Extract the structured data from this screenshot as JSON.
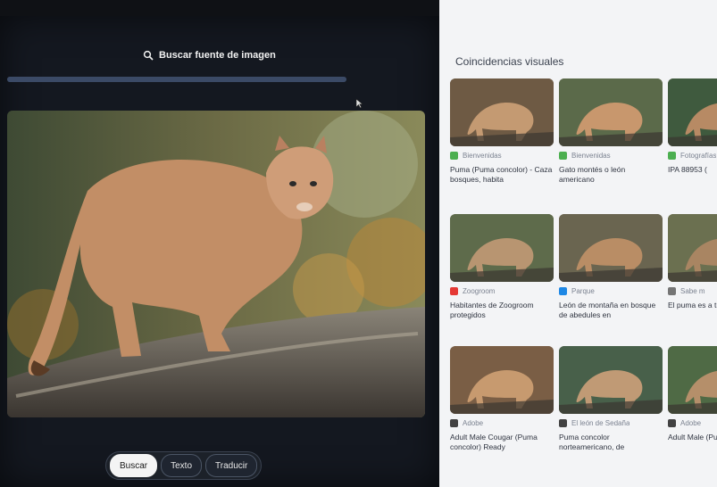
{
  "lens": {
    "search_source_label": "Buscar fuente de imagen",
    "progress": 1.0,
    "actions": [
      {
        "label": "Buscar",
        "active": true
      },
      {
        "label": "Texto",
        "active": false
      },
      {
        "label": "Traducir",
        "active": false
      }
    ]
  },
  "results": {
    "title": "Coincidencias visuales",
    "items": [
      {
        "source": "Bienvenidas",
        "caption": "Puma (Puma concolor) - Caza bosques, habita",
        "icon_color": "#4caf50"
      },
      {
        "source": "Bienvenidas",
        "caption": "Gato montés o león americano",
        "icon_color": "#4caf50"
      },
      {
        "source": "Fotografías",
        "caption": "IPA 88953 (",
        "icon_color": "#4caf50"
      },
      {
        "source": "Zoogroom",
        "caption": "Habitantes de Zoogroom protegidos",
        "icon_color": "#e53935"
      },
      {
        "source": "Parque",
        "caption": "León de montaña en bosque de abedules en",
        "icon_color": "#1e88e5"
      },
      {
        "source": "Sabe m",
        "caption": "El puma es a través de a",
        "icon_color": "#757575"
      },
      {
        "source": "Adobe",
        "caption": "Adult Male Cougar (Puma concolor) Ready",
        "icon_color": "#424242"
      },
      {
        "source": "El león de Sedaña",
        "caption": "Puma concolor norteamericano, de",
        "icon_color": "#424242"
      },
      {
        "source": "Adobe",
        "caption": "Adult Male (Puma conco",
        "icon_color": "#424242"
      }
    ]
  },
  "colors": {
    "panel_dark": "#141820",
    "results_bg": "#f3f4f6",
    "accent": "#3b4a66"
  }
}
